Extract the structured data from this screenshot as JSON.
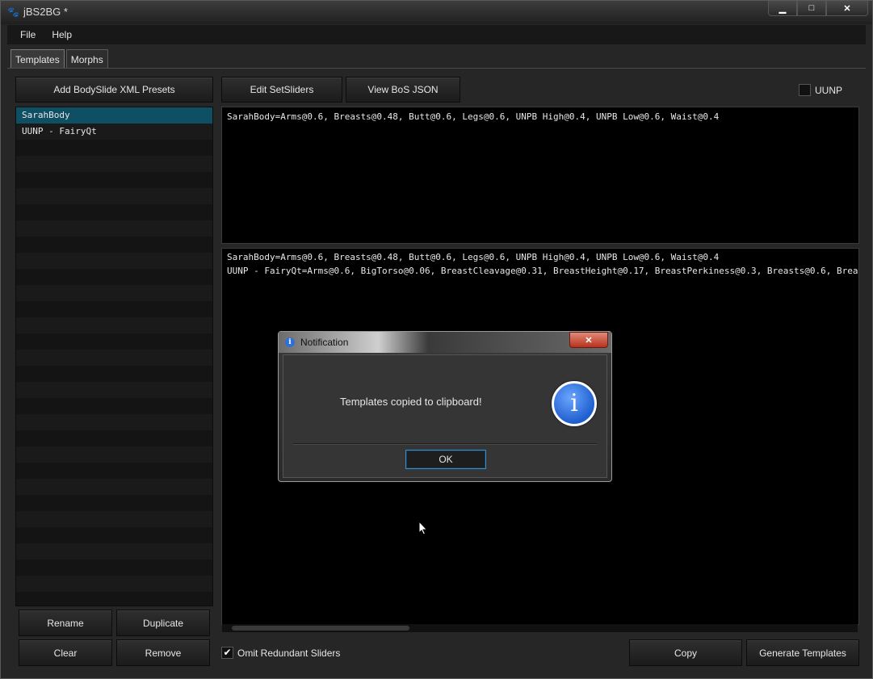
{
  "window": {
    "title": "jBS2BG *",
    "minimize": "▁",
    "maximize": "□",
    "close": "✕"
  },
  "menu": [
    "File",
    "Help"
  ],
  "tabs": [
    "Templates",
    "Morphs"
  ],
  "toolbar": {
    "add_presets": "Add BodySlide XML Presets",
    "edit_setsliders": "Edit SetSliders",
    "view_bos_json": "View BoS JSON",
    "uunp_label": "UUNP",
    "uunp_checked": false
  },
  "presets": [
    "SarahBody",
    "UUNP - FairyQt"
  ],
  "selected_preset": "SarahBody",
  "preview_text": "SarahBody=Arms@0.6, Breasts@0.48, Butt@0.6, Legs@0.6, UNPB High@0.4, UNPB Low@0.6, Waist@0.4",
  "templates_output": [
    "SarahBody=Arms@0.6, Breasts@0.48, Butt@0.6, Legs@0.6, UNPB High@0.4, UNPB Low@0.6, Waist@0.4",
    "UUNP - FairyQt=Arms@0.6, BigTorso@0.06, BreastCleavage@0.31, BreastHeight@0.17, BreastPerkiness@0.3, Breasts@0.6, Breas"
  ],
  "list_buttons": {
    "rename": "Rename",
    "duplicate": "Duplicate",
    "clear": "Clear",
    "remove": "Remove"
  },
  "bottom": {
    "omit_label": "Omit Redundant Sliders",
    "omit_checked": true,
    "copy": "Copy",
    "generate": "Generate Templates"
  },
  "dialog": {
    "title": "Notification",
    "message": "Templates copied to clipboard!",
    "ok": "OK",
    "close": "✕",
    "icon_glyph": "i"
  },
  "colors": {
    "selection": "#0e4f63",
    "accent": "#3c8ec9",
    "info_blue": "#1f5fcf"
  }
}
